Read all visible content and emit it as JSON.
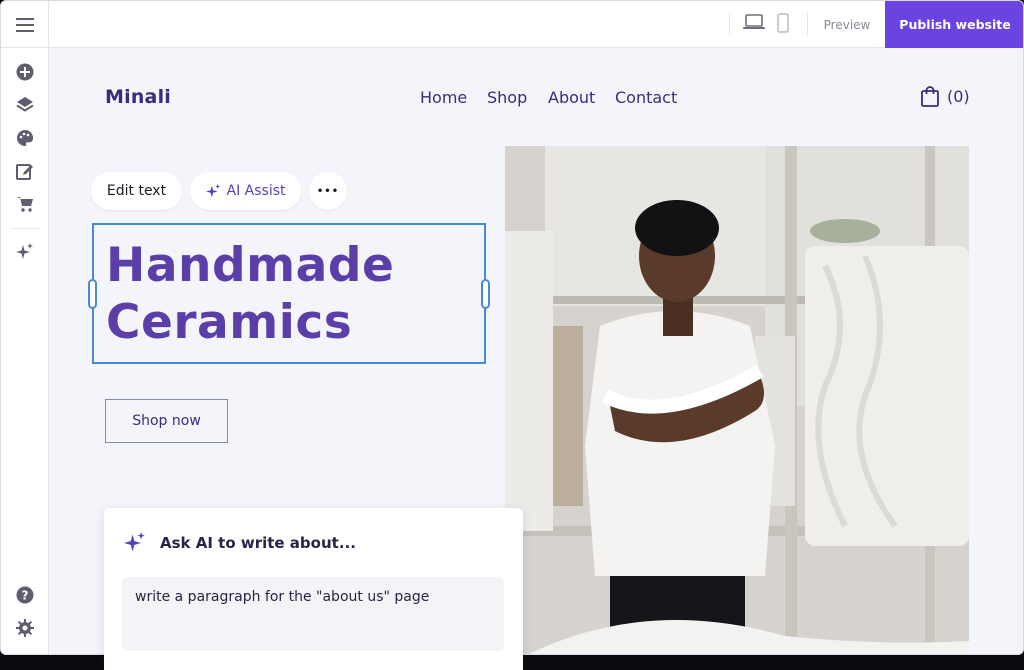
{
  "topbar": {
    "menu_icon": "hamburger-icon",
    "device_icons": [
      "laptop-icon",
      "mobile-icon"
    ],
    "preview_label": "Preview",
    "publish_label": "Publish website",
    "accent_color": "#6a43e0"
  },
  "rail": {
    "top_icons": [
      "add-icon",
      "layers-icon",
      "palette-icon",
      "edit-icon",
      "cart-icon",
      "sparkles-icon"
    ],
    "bottom_icons": [
      "help-icon",
      "settings-icon"
    ]
  },
  "site": {
    "logo": "Minali",
    "nav": [
      "Home",
      "Shop",
      "About",
      "Contact"
    ],
    "cart_count": "(0)",
    "toolbar": {
      "edit_text": "Edit text",
      "ai_assist": "AI Assist",
      "more": "•••"
    },
    "headline_line1": "Handmade",
    "headline_line2": "Ceramics",
    "cta": "Shop now",
    "headline_color": "#5b3fa8"
  },
  "ai_panel": {
    "title": "Ask AI to write about...",
    "input_value": "write a paragraph for the \"about us\" page"
  }
}
